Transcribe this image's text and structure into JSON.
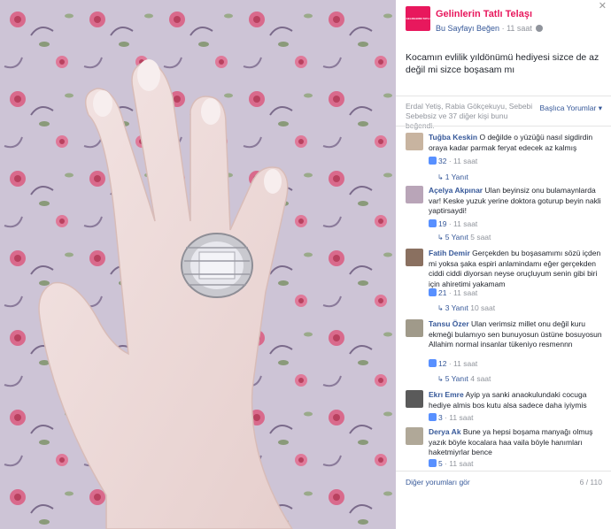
{
  "post": {
    "page_name": "Gelinlerin Tatlı Telaşı",
    "avatar_text": "GELINLERIN TATLI TELAŞI",
    "like_page_label": "Bu Sayfayı Beğen",
    "time": "11 saat",
    "separator": " · ",
    "text": "Kocamın evlilik yıldönümü hediyesi sizce de az değil mi sizce boşasam mı",
    "close_glyph": "✕"
  },
  "likes": {
    "summary": "Erdal Yetiş, Rabia Gökçekuyu, Sebebi Sebebsiz ve 37 diğer kişi bunu beğendi.",
    "sort_label": "Başlıca Yorumlar",
    "sort_caret": "▾"
  },
  "comments": [
    {
      "name": "Tuğba Keskin",
      "text": "O değilde o yüzüğü nasıl sigdirdin oraya kadar parmak feryat edecek az kalmış",
      "likes": "32",
      "time": "11 saat",
      "replies": "1 Yanıt",
      "reply_time": ""
    },
    {
      "name": "Açelya Akpınar",
      "text": "Ulan beyinsiz onu bulamaynlarda var! Keske yuzuk yerine doktora goturup beyin nakli yaptirsaydi!",
      "likes": "19",
      "time": "11 saat",
      "replies": "5 Yanıt",
      "reply_time": "5 saat"
    },
    {
      "name": "Fatih Demir",
      "text": "Gerçekden bu boşasamımı sözü içden mi yoksa şaka espiri anlamindamı eğer gerçekden ciddi ciddi diyorsan neyse oruçluyum senin gibi biri için ahiretimi yakamam",
      "likes": "21",
      "time": "11 saat",
      "replies": "3 Yanıt",
      "reply_time": "10 saat"
    },
    {
      "name": "Tansu Özer",
      "text": "Ulan verimsiz millet onu değil kuru ekmeği bulamıyo sen bunuyosun üstüne bosuyosun Allahim normal insanlar tükeniyo resmennn",
      "likes": "12",
      "time": "11 saat",
      "replies": "5 Yanıt",
      "reply_time": "4 saat"
    },
    {
      "name": "Ekrı Emre",
      "text": "Ayip ya sanki anaokulundaki cocuga hediye almis bos kutu alsa sadece daha iyiymis",
      "likes": "3",
      "time": "11 saat",
      "replies": "",
      "reply_time": ""
    },
    {
      "name": "Derya Ak",
      "text": "Bune ya hepsi boşama manyağı olmuş yazık böyle kocalara haa vaila böyle hanımları haketmiyrlar bence",
      "likes": "5",
      "time": "11 saat",
      "replies": "",
      "reply_time": ""
    }
  ],
  "footer": {
    "more_label": "Diğer yorumları gör",
    "count": "6 / 110"
  },
  "colors": {
    "brand": "#e8185d",
    "link": "#365899",
    "meta": "#90949c"
  }
}
